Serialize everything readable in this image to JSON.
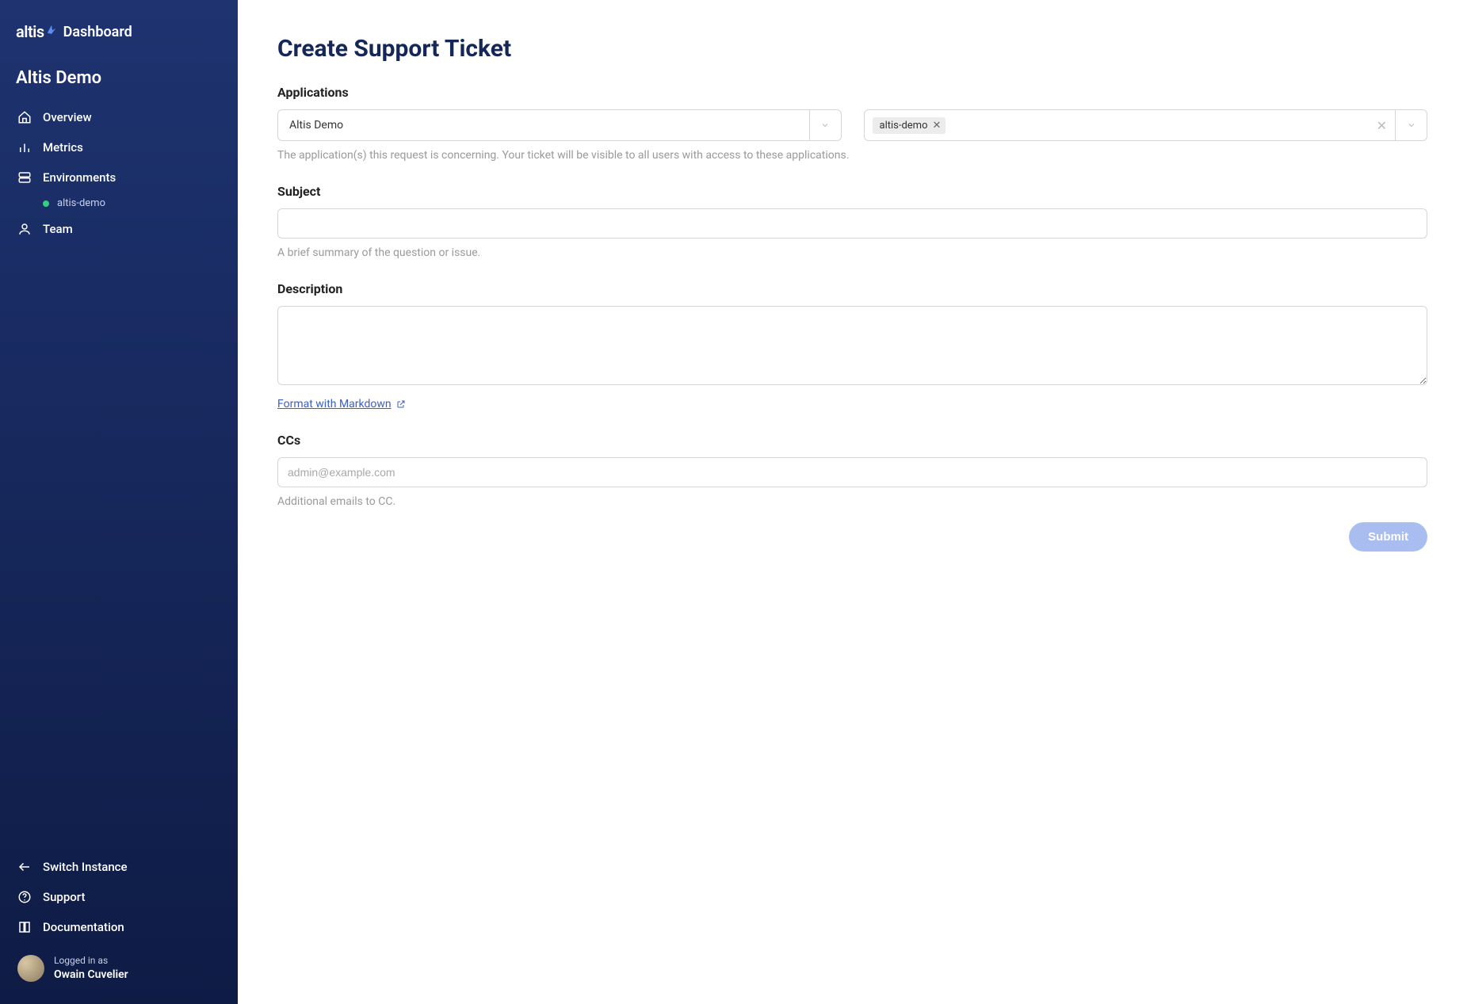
{
  "brand": {
    "logo_text": "altis",
    "title": "Dashboard"
  },
  "workspace": "Altis Demo",
  "nav": {
    "overview": "Overview",
    "metrics": "Metrics",
    "environments": "Environments",
    "env_sub": "altis-demo",
    "team": "Team"
  },
  "bottom_nav": {
    "switch": "Switch Instance",
    "support": "Support",
    "docs": "Documentation"
  },
  "user": {
    "logged_in_as": "Logged in as",
    "name": "Owain Cuvelier"
  },
  "page": {
    "title": "Create Support Ticket",
    "applications": {
      "label": "Applications",
      "selected": "Altis Demo",
      "tags": [
        "altis-demo"
      ],
      "help": "The application(s) this request is concerning. Your ticket will be visible to all users with access to these applications."
    },
    "subject": {
      "label": "Subject",
      "value": "",
      "help": "A brief summary of the question or issue."
    },
    "description": {
      "label": "Description",
      "value": "",
      "md_link": "Format with Markdown"
    },
    "ccs": {
      "label": "CCs",
      "placeholder": "admin@example.com",
      "help": "Additional emails to CC."
    },
    "submit": "Submit"
  }
}
